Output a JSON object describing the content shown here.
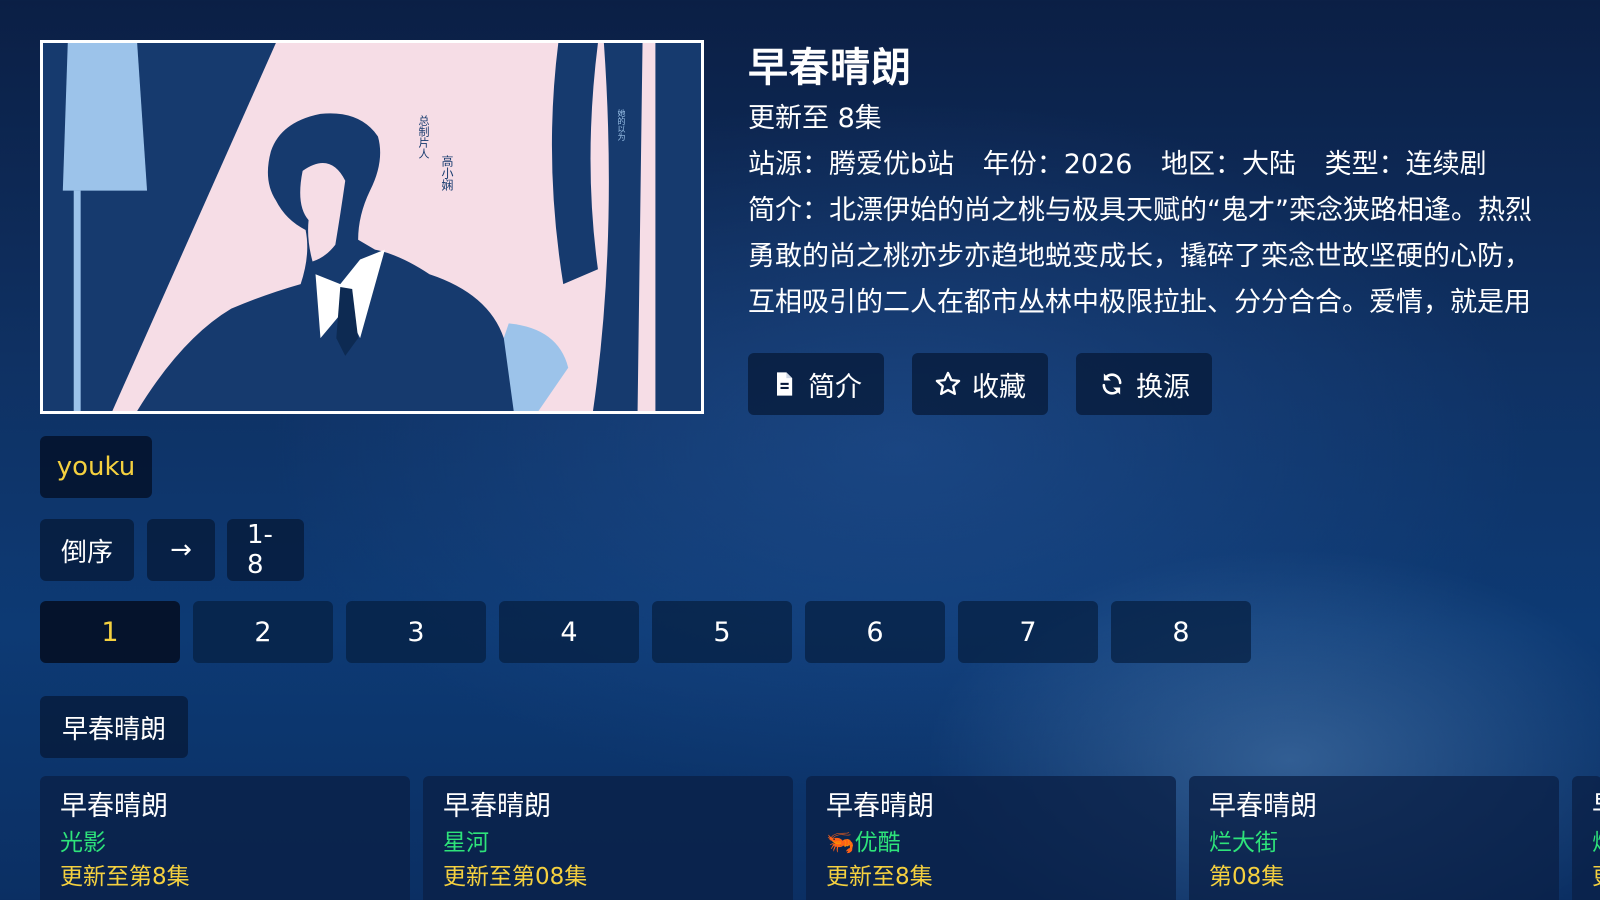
{
  "detail": {
    "title": "早春晴朗",
    "update_status": "更新至 8集",
    "meta": {
      "source": "站源：腾爱优b站",
      "year": "年份：2026",
      "region": "地区：大陆",
      "genre": "类型：连续剧"
    },
    "description": "简介：北漂伊始的尚之桃与极具天赋的“鬼才”栾念狭路相逢。热烈勇敢的尚之桃亦步亦趋地蜕变成长，撬碎了栾念世故坚硬的心防，互相吸引的二人在都市丛林中极限拉扯、分分合合。爱情，就是用光所有",
    "poster_text": {
      "credit_role": "总制片人",
      "credit_name": "高小娴",
      "tagline": "她的以为"
    }
  },
  "actions": [
    {
      "label": "简介",
      "icon": "document-icon"
    },
    {
      "label": "收藏",
      "icon": "star-icon"
    },
    {
      "label": "换源",
      "icon": "refresh-icon"
    }
  ],
  "provider": {
    "selected": "youku"
  },
  "controls": {
    "sort_label": "倒序",
    "arrow_label": "→",
    "range_label": "1-8"
  },
  "episodes": [
    "1",
    "2",
    "3",
    "4",
    "5",
    "6",
    "7",
    "8"
  ],
  "selected_episode": "1",
  "related": {
    "group_label": "早春晴朗",
    "cards": [
      {
        "title": "早春晴朗",
        "source": "光影",
        "update": "更新至第8集"
      },
      {
        "title": "早春晴朗",
        "source": "星河",
        "update": "更新至第08集"
      },
      {
        "title": "早春晴朗",
        "source": "优酷",
        "source_icon": "shrimp-icon",
        "update": "更新至8集"
      },
      {
        "title": "早春晴朗",
        "source": "烂大街",
        "update": "第08集"
      },
      {
        "title": "早",
        "source": "烂",
        "update": "更"
      }
    ]
  },
  "colors": {
    "accent_yellow": "#f4d03f",
    "source_green": "#2ee37a",
    "button_bg": "#06183a"
  }
}
